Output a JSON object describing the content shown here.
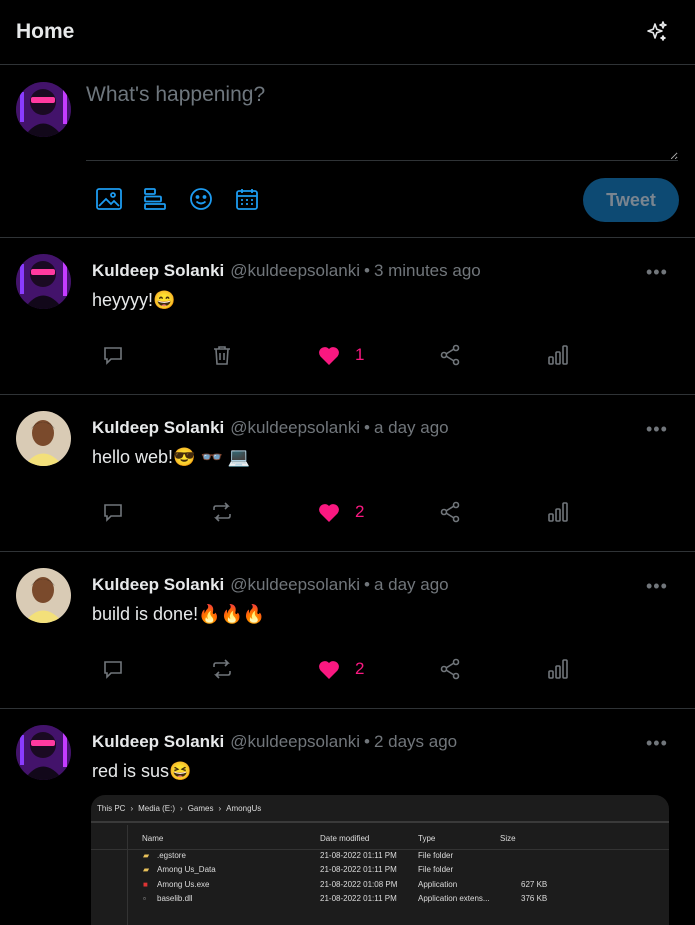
{
  "header": {
    "title": "Home",
    "icon": "sparkle-icon"
  },
  "composer": {
    "placeholder": "What's happening?",
    "tweet_label": "Tweet",
    "tools": [
      "image-icon",
      "poll-icon",
      "emoji-icon",
      "schedule-icon"
    ]
  },
  "colors": {
    "accent": "#1d9bf0",
    "like": "#f91880",
    "muted": "#71767b",
    "border": "#2f3336",
    "tweet_btn": "#0d4a73"
  },
  "tweets": [
    {
      "name": "Kuldeep Solanki",
      "handle": "@kuldeepsolanki",
      "time": "3 minutes ago",
      "text": "heyyyy!😄",
      "likes": "1",
      "second_action": "delete-icon"
    },
    {
      "name": "Kuldeep Solanki",
      "handle": "@kuldeepsolanki",
      "time": "a day ago",
      "text": "hello web!😎 👓 💻",
      "likes": "2",
      "second_action": "retweet-icon"
    },
    {
      "name": "Kuldeep Solanki",
      "handle": "@kuldeepsolanki",
      "time": "a day ago",
      "text": "build is done!🔥🔥🔥",
      "likes": "2",
      "second_action": "retweet-icon"
    },
    {
      "name": "Kuldeep Solanki",
      "handle": "@kuldeepsolanki",
      "time": "2 days ago",
      "text": "red is sus😆",
      "likes": "",
      "second_action": ""
    }
  ],
  "attachment": {
    "breadcrumb": [
      "This PC",
      "Media (E:)",
      "Games",
      "AmongUs"
    ],
    "columns": [
      "Name",
      "Date modified",
      "Type",
      "Size"
    ],
    "rows": [
      {
        "name": ".egstore",
        "date": "21-08-2022 01:11 PM",
        "type": "File folder",
        "size": ""
      },
      {
        "name": "Among Us_Data",
        "date": "21-08-2022 01:11 PM",
        "type": "File folder",
        "size": ""
      },
      {
        "name": "Among Us.exe",
        "date": "21-08-2022 01:08 PM",
        "type": "Application",
        "size": "627 KB"
      },
      {
        "name": "baselib.dll",
        "date": "21-08-2022 01:11 PM",
        "type": "Application extens...",
        "size": "376 KB"
      }
    ]
  }
}
